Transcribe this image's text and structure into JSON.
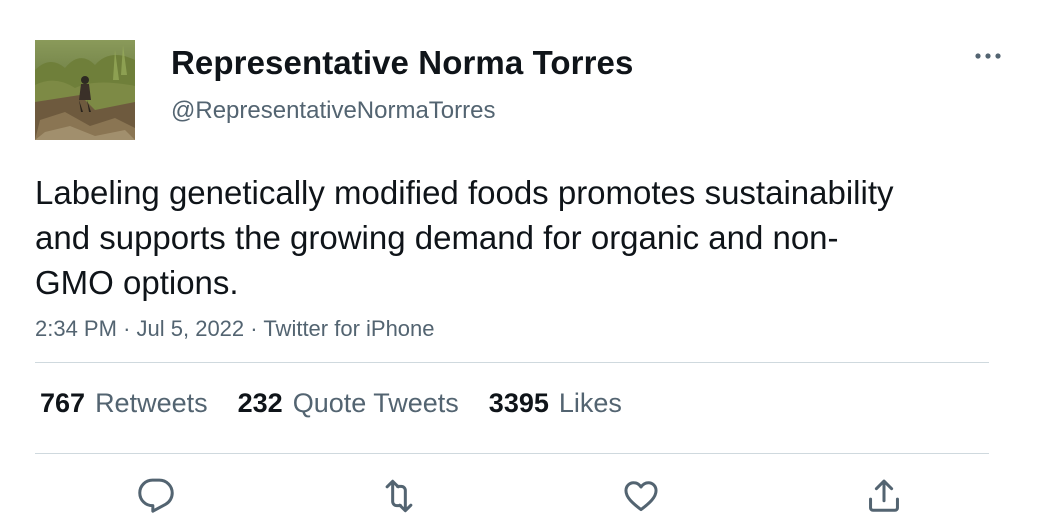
{
  "tweet": {
    "author": {
      "display_name": "Representative Norma Torres",
      "handle": "@RepresentativeNormaTorres"
    },
    "text": "Labeling genetically modified foods promotes sustainability and supports the growing demand for organic and non-GMO options.",
    "time": "2:34 PM",
    "separator": "·",
    "date": "Jul 5, 2022",
    "source": "Twitter for iPhone",
    "stats": {
      "retweets_count": "767",
      "retweets_label": "Retweets",
      "quotes_count": "232",
      "quotes_label": "Quote Tweets",
      "likes_count": "3395",
      "likes_label": "Likes"
    }
  },
  "icons": {
    "more": "more-horizontal-icon",
    "reply": "reply-icon",
    "retweet": "retweet-icon",
    "like": "heart-icon",
    "share": "share-icon"
  },
  "colors": {
    "text_primary": "#0f1419",
    "text_secondary": "#536471",
    "divider": "#cfd9de"
  }
}
